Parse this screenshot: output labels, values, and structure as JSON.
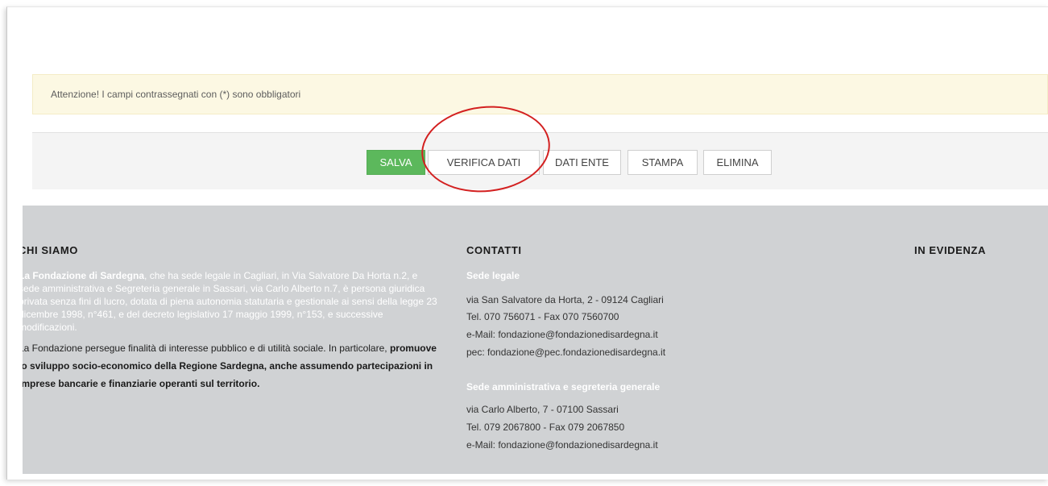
{
  "alert": {
    "text": "Attenzione! I campi contrassegnati con (*) sono obbligatori"
  },
  "toolbar": {
    "save_label": "SALVA",
    "verify_label": "VERIFICA DATI",
    "dati_ente_label": "DATI ENTE",
    "stampa_label": "STAMPA",
    "elimina_label": "ELIMINA"
  },
  "colors": {
    "save_button": "#5cb85c",
    "alert_background": "#fcf8e3",
    "footer_background": "#d0d2d4",
    "highlight_ring": "#d32020"
  },
  "footer": {
    "chi_siamo": {
      "title": "CHI SIAMO",
      "para1_bold": "La Fondazione di Sardegna",
      "para1_text": ", che ha sede legale in Cagliari, in Via Salvatore Da Horta n.2, e sede amministrativa e Segreteria generale in Sassari, via Carlo Alberto n.7, è persona giuridica privata senza fini di lucro, dotata di piena autonomia statutaria e gestionale ai sensi della legge 23 dicembre 1998, n°461, e del decreto legislativo 17 maggio 1999, n°153, e successive modificazioni.",
      "para2_text": "La Fondazione persegue finalità di interesse pubblico e di utilità sociale. In particolare, ",
      "para2_bold": "promuove lo sviluppo socio-economico della Regione Sardegna, anche assumendo partecipazioni in imprese bancarie e finanziarie operanti sul territorio."
    },
    "contatti": {
      "title": "CONTATTI",
      "sede_legale_heading": "Sede legale",
      "sede_legale_address": "via San Salvatore da Horta, 2 - 09124 Cagliari",
      "sede_legale_tel": "Tel. 070 756071 - Fax  070 7560700",
      "sede_legale_email": "e-Mail: fondazione@fondazionedisardegna.it",
      "sede_legale_pec": "pec: fondazione@pec.fondazionedisardegna.it",
      "sede_amm_heading": "Sede amministrativa e segreteria generale",
      "sede_amm_address": "via Carlo Alberto, 7 - 07100 Sassari",
      "sede_amm_tel": "Tel. 079 2067800 - Fax  079 2067850",
      "sede_amm_email": "e-Mail: fondazione@fondazionedisardegna.it"
    },
    "in_evidenza": {
      "title": "IN EVIDENZA"
    }
  }
}
